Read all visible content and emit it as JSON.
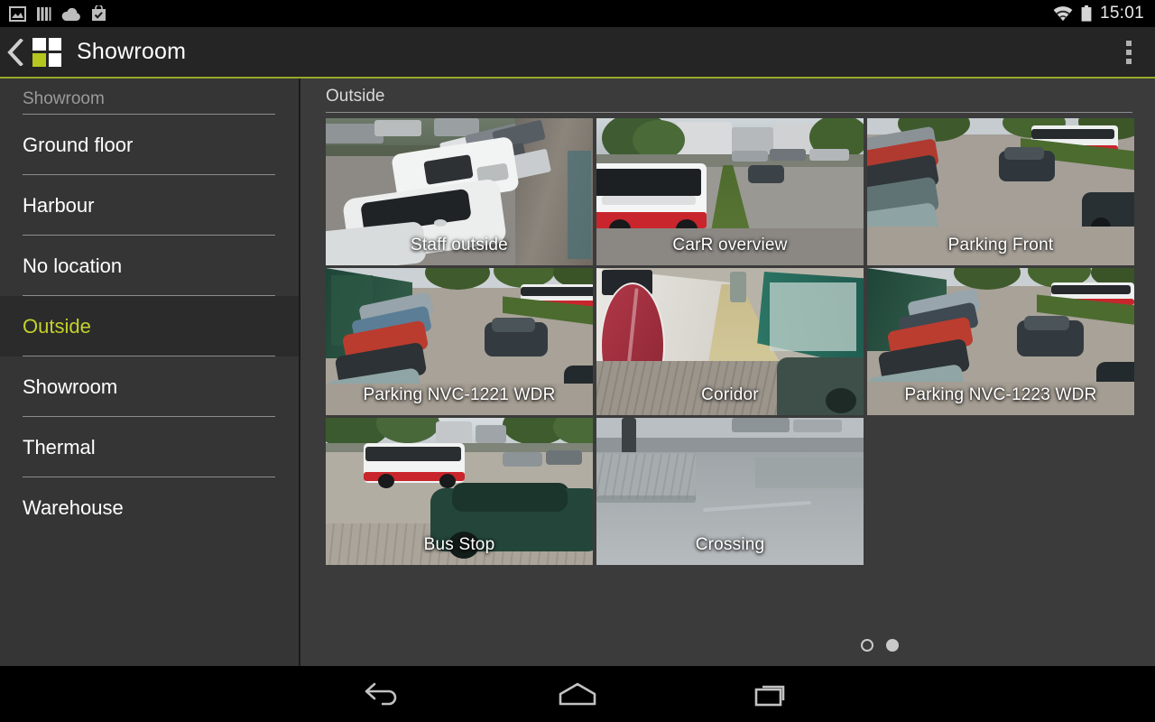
{
  "statusbar": {
    "icons": [
      "image-icon",
      "signal-bars-icon",
      "cloud-upload-icon",
      "shopping-bag-check-icon"
    ],
    "wifi_icon": "wifi-icon",
    "battery_icon": "battery-full-icon",
    "time": "15:01"
  },
  "appbar": {
    "back_icon": "back-chevron-icon",
    "logo_name": "app-logo",
    "title": "Showroom",
    "overflow_icon": "overflow-menu-icon",
    "accent_color": "#b5c61f"
  },
  "sidebar": {
    "header": "Showroom",
    "items": [
      {
        "label": "Ground floor",
        "active": false
      },
      {
        "label": "Harbour",
        "active": false
      },
      {
        "label": "No location",
        "active": false
      },
      {
        "label": "Outside",
        "active": true
      },
      {
        "label": "Showroom",
        "active": false
      },
      {
        "label": "Thermal",
        "active": false
      },
      {
        "label": "Warehouse",
        "active": false
      }
    ],
    "active_color": "#c4d12b"
  },
  "content": {
    "title": "Outside",
    "cameras": [
      {
        "label": "Staff outside",
        "scene": "parking-vans"
      },
      {
        "label": "CarR overview",
        "scene": "bus-street"
      },
      {
        "label": "Parking Front",
        "scene": "parking-lane"
      },
      {
        "label": "Parking NVC-1221 WDR",
        "scene": "parking-cars"
      },
      {
        "label": "Coridor",
        "scene": "corridor"
      },
      {
        "label": "Parking NVC-1223 WDR",
        "scene": "parking-cars"
      },
      {
        "label": "Bus Stop",
        "scene": "bus-stop"
      },
      {
        "label": "Crossing",
        "scene": "crossing"
      }
    ],
    "pagination": {
      "pages": 2,
      "current": 2
    }
  },
  "navbar": {
    "back_label": "back-icon",
    "home_label": "home-icon",
    "recents_label": "recents-icon"
  }
}
